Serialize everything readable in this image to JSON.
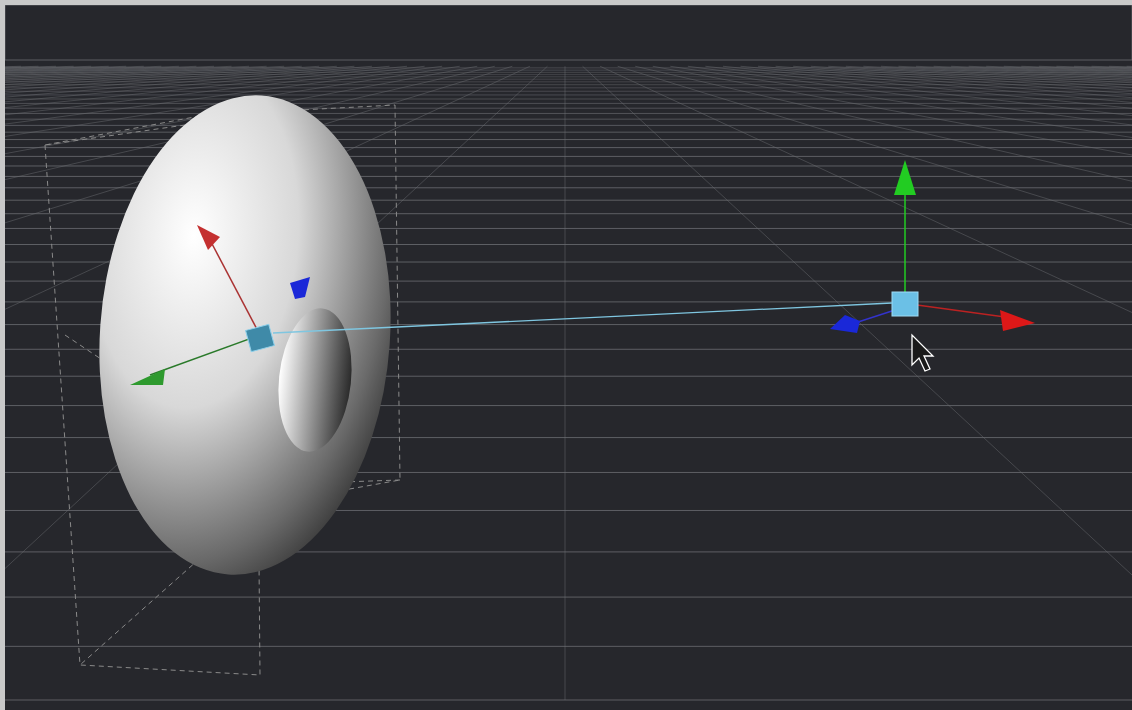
{
  "viewport": {
    "objects": [
      {
        "kind": "torus"
      }
    ],
    "gizmos": [
      {
        "kind": "axes"
      },
      {
        "kind": "axes"
      }
    ],
    "cursor": {
      "kind": "arrow"
    }
  }
}
